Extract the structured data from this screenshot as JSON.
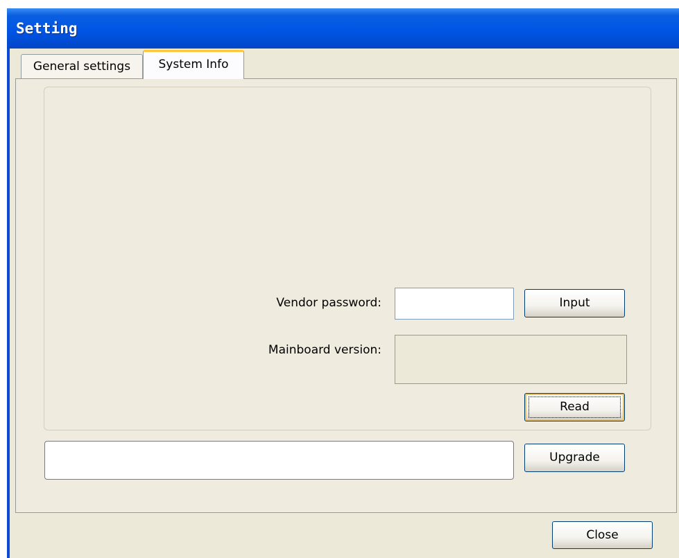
{
  "window": {
    "title": "Setting"
  },
  "tabs": [
    {
      "label": "General settings",
      "selected": false
    },
    {
      "label": "System Info",
      "selected": true
    }
  ],
  "system_info": {
    "vendor_password": {
      "label": "Vendor password:",
      "value": ""
    },
    "input_button": "Input",
    "mainboard_version": {
      "label": "Mainboard version:",
      "value": ""
    },
    "read_button": "Read"
  },
  "upgrade": {
    "path_value": "",
    "button": "Upgrade"
  },
  "footer": {
    "close_button": "Close"
  },
  "colors": {
    "titlebar": "#0055e5",
    "window_bg": "#ece9d8",
    "active_tab_accent": "#ffc83c",
    "button_border": "#003c74"
  }
}
